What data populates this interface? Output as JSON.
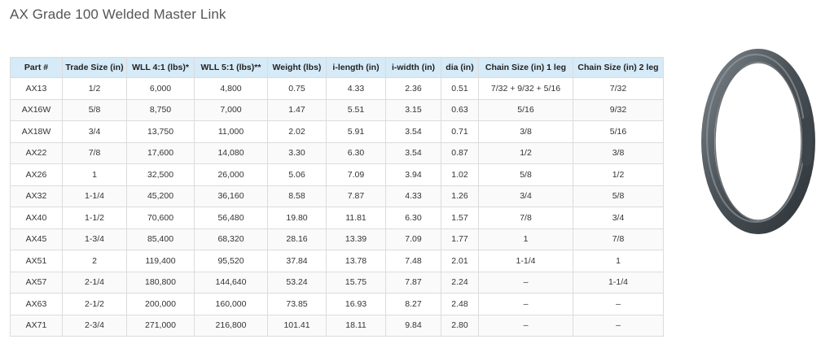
{
  "page": {
    "title": "AX Grade 100 Welded Master Link"
  },
  "table": {
    "headers": [
      "Part #",
      "Trade Size (in)",
      "WLL 4:1 (lbs)*",
      "WLL 5:1 (lbs)**",
      "Weight (lbs)",
      "i-length (in)",
      "i-width (in)",
      "dia (in)",
      "Chain Size (in) 1 leg",
      "Chain Size (in) 2 leg"
    ],
    "rows": [
      [
        "AX13",
        "1/2",
        "6,000",
        "4,800",
        "0.75",
        "4.33",
        "2.36",
        "0.51",
        "7/32 + 9/32 + 5/16",
        "7/32"
      ],
      [
        "AX16W",
        "5/8",
        "8,750",
        "7,000",
        "1.47",
        "5.51",
        "3.15",
        "0.63",
        "5/16",
        "9/32"
      ],
      [
        "AX18W",
        "3/4",
        "13,750",
        "11,000",
        "2.02",
        "5.91",
        "3.54",
        "0.71",
        "3/8",
        "5/16"
      ],
      [
        "AX22",
        "7/8",
        "17,600",
        "14,080",
        "3.30",
        "6.30",
        "3.54",
        "0.87",
        "1/2",
        "3/8"
      ],
      [
        "AX26",
        "1",
        "32,500",
        "26,000",
        "5.06",
        "7.09",
        "3.94",
        "1.02",
        "5/8",
        "1/2"
      ],
      [
        "AX32",
        "1-1/4",
        "45,200",
        "36,160",
        "8.58",
        "7.87",
        "4.33",
        "1.26",
        "3/4",
        "5/8"
      ],
      [
        "AX40",
        "1-1/2",
        "70,600",
        "56,480",
        "19.80",
        "11.81",
        "6.30",
        "1.57",
        "7/8",
        "3/4"
      ],
      [
        "AX45",
        "1-3/4",
        "85,400",
        "68,320",
        "28.16",
        "13.39",
        "7.09",
        "1.77",
        "1",
        "7/8"
      ],
      [
        "AX51",
        "2",
        "119,400",
        "95,520",
        "37.84",
        "13.78",
        "7.48",
        "2.01",
        "1-1/4",
        "1"
      ],
      [
        "AX57",
        "2-1/4",
        "180,800",
        "144,640",
        "53.24",
        "15.75",
        "7.87",
        "2.24",
        "–",
        "1-1/4"
      ],
      [
        "AX63",
        "2-1/2",
        "200,000",
        "160,000",
        "73.85",
        "16.93",
        "8.27",
        "2.48",
        "–",
        "–"
      ],
      [
        "AX71",
        "2-3/4",
        "271,000",
        "216,800",
        "101.41",
        "18.11",
        "9.84",
        "2.80",
        "–",
        "–"
      ]
    ]
  },
  "image": {
    "name": "master-link-photo",
    "link_color": "#4a5258"
  }
}
